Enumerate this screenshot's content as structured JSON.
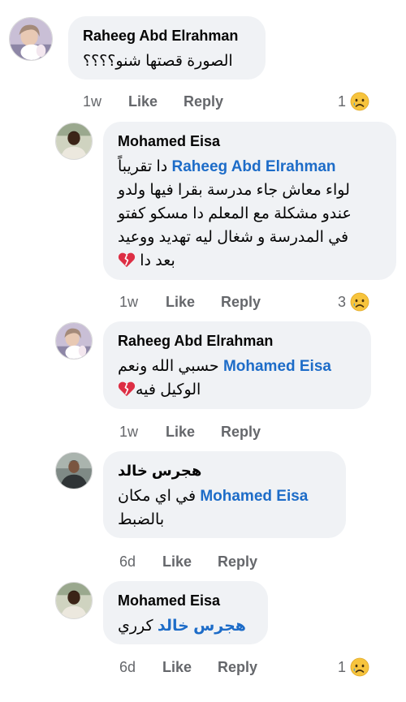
{
  "colors": {
    "mention": "#1d6cc8",
    "meta": "#65676b",
    "bubble": "#f0f2f5"
  },
  "comments": [
    {
      "author": "Raheeg Abd Elrahman",
      "lines": [
        "الصورة قصتها شنو؟؟؟؟"
      ],
      "time": "1w",
      "like": "Like",
      "reply": "Reply",
      "reaction_count": "1",
      "reaction": "sad-face-icon"
    },
    {
      "author": "Mohamed Eisa",
      "mention": "Raheeg Abd Elrahman",
      "mention_suffix": "دا تقريباً",
      "lines": [
        "لواء معاش جاء مدرسة بقرا فيها ولدو",
        "عندو مشكلة مع المعلم دا مسكو كفتو",
        "في المدرسة و شغال ليه تهديد ووعيد",
        "بعد دا"
      ],
      "end_emoji": "broken-heart-icon",
      "time": "1w",
      "like": "Like",
      "reply": "Reply",
      "reaction_count": "3",
      "reaction": "sad-face-icon"
    },
    {
      "author": "Raheeg Abd Elrahman",
      "mention": "Mohamed Eisa",
      "mention_suffix": "حسبي الله ونعم",
      "lines": [
        "الوكيل فيه"
      ],
      "end_emoji": "broken-heart-icon",
      "time": "1w",
      "like": "Like",
      "reply": "Reply"
    },
    {
      "author": "هجرس خالد",
      "mention": "Mohamed Eisa",
      "mention_suffix": "في اي مكان",
      "lines": [
        "بالضبط"
      ],
      "time": "6d",
      "like": "Like",
      "reply": "Reply"
    },
    {
      "author": "Mohamed Eisa",
      "mention": "هجرس خالد",
      "mention_suffix": "كرري",
      "time": "6d",
      "like": "Like",
      "reply": "Reply",
      "reaction_count": "1",
      "reaction": "sad-face-icon"
    }
  ]
}
